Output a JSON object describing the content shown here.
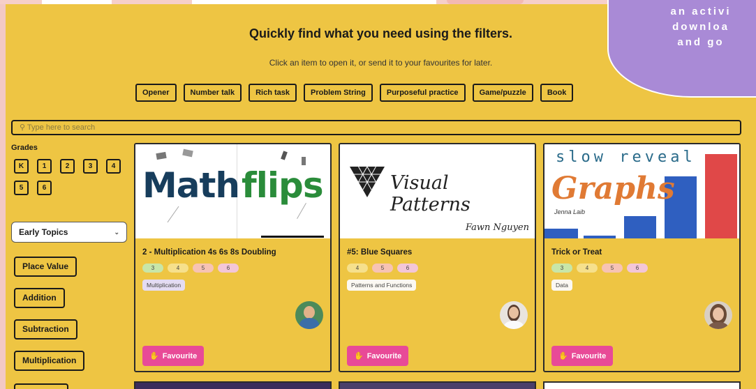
{
  "header": {
    "title": "Quickly find what you need using the filters.",
    "subtitle": "Click an item to open it, or send it to your favourites for later."
  },
  "filter_chips": [
    "Opener",
    "Number talk",
    "Rich task",
    "Problem String",
    "Purposeful practice",
    "Game/puzzle",
    "Book"
  ],
  "search": {
    "placeholder": "Type here to search"
  },
  "grades": {
    "label": "Grades",
    "items": [
      "K",
      "1",
      "2",
      "3",
      "4",
      "5",
      "6"
    ]
  },
  "topic_select": {
    "value": "Early Topics"
  },
  "topics": [
    "Place Value",
    "Addition",
    "Subtraction",
    "Multiplication"
  ],
  "cards": [
    {
      "thumb_text": [
        "Math",
        "flips"
      ],
      "title": "2 - Multiplication 4s 6s 8s Doubling",
      "grades": [
        "3",
        "4",
        "5",
        "6"
      ],
      "tag": "Multiplication",
      "favourite": "Favourite"
    },
    {
      "thumb_text": [
        "Visual Patterns",
        "Fawn Nguyen"
      ],
      "title": "#5: Blue Squares",
      "grades": [
        "4",
        "5",
        "6"
      ],
      "tag": "Patterns and Functions",
      "favourite": "Favourite"
    },
    {
      "thumb_text": [
        "slow reveal",
        "Graphs",
        "Jenna Laib"
      ],
      "title": "Trick or Treat",
      "grades": [
        "3",
        "4",
        "5",
        "6"
      ],
      "tag": "Data",
      "favourite": "Favourite"
    }
  ],
  "overlay": {
    "lines": [
      "an activi",
      "downloa",
      "and go"
    ]
  },
  "colors": {
    "panel": "#eec543",
    "favourite": "#e84a97",
    "overlay": "#a98ad6",
    "page": "#f3c9c4"
  }
}
